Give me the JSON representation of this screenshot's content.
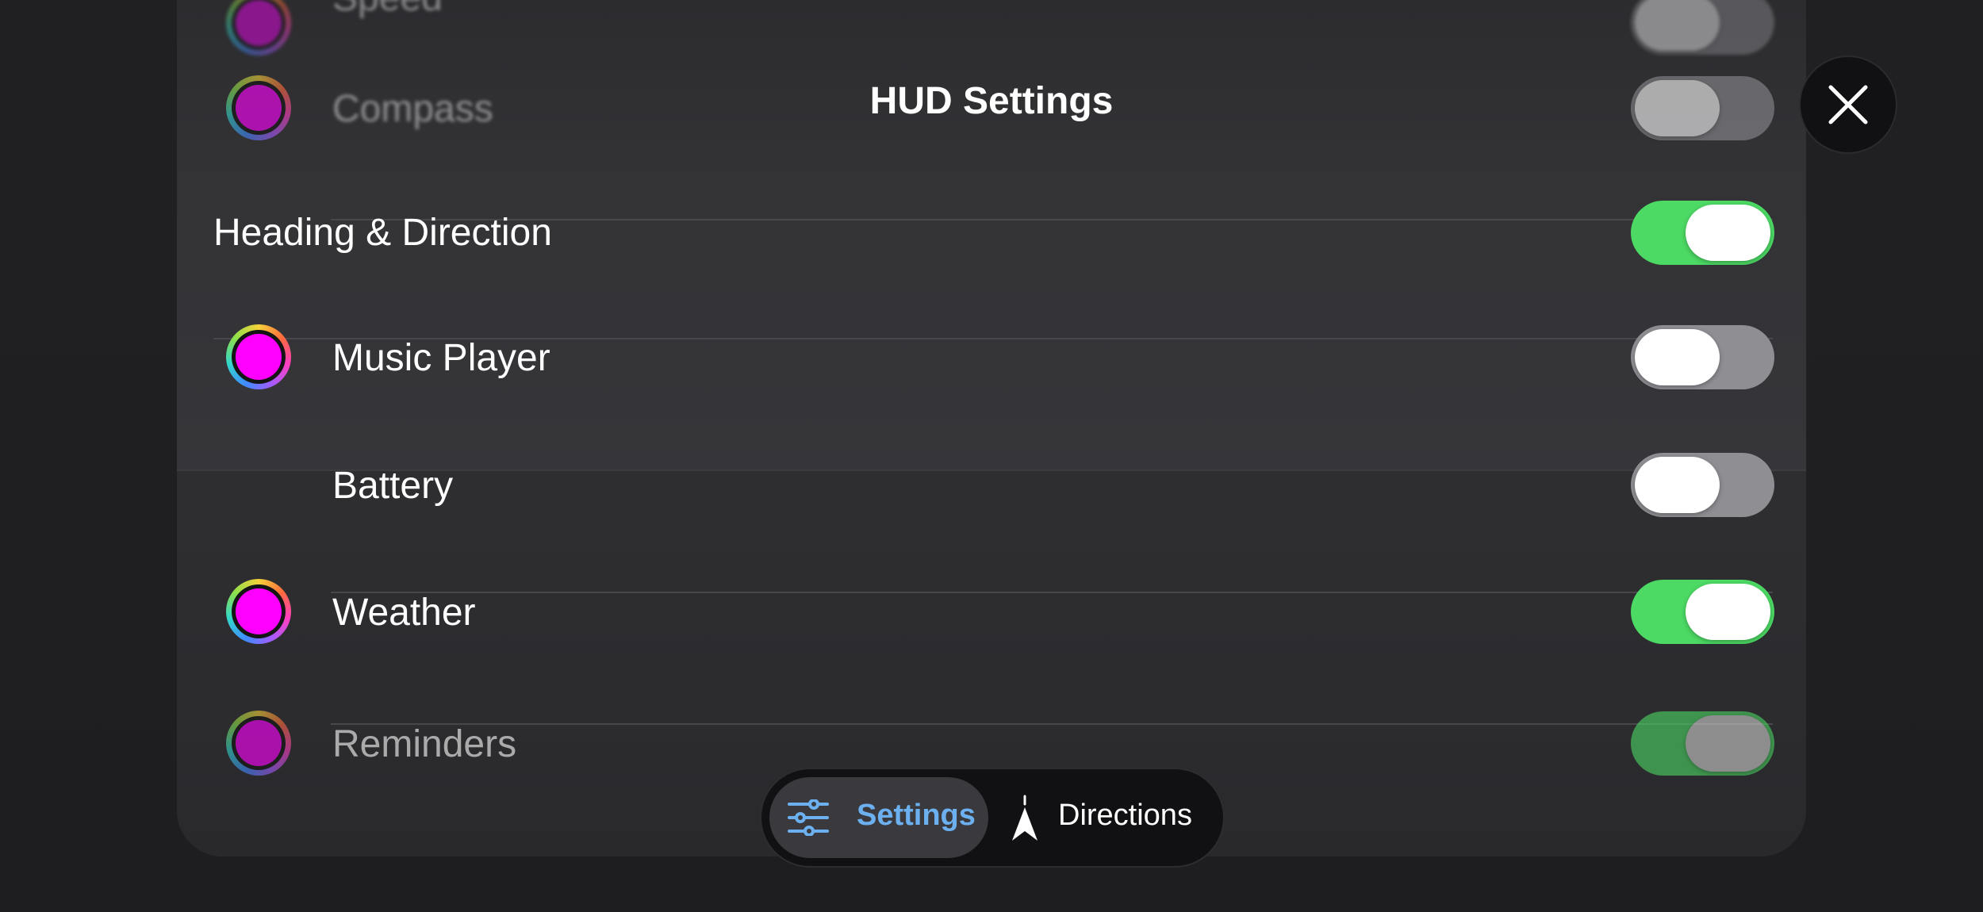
{
  "header": {
    "title": "HUD Settings"
  },
  "close_button": {
    "icon": "close-icon"
  },
  "settings": [
    {
      "label": "Speed",
      "icon": "color-ring-icon",
      "toggle": "off"
    },
    {
      "label": "Compass",
      "icon": "color-ring-icon",
      "toggle": "off"
    },
    {
      "label": "Heading & Direction",
      "toggle": "on"
    },
    {
      "label": "Music Player",
      "icon": "color-ring-icon",
      "toggle": "off"
    },
    {
      "label": "Battery",
      "toggle": "off"
    },
    {
      "label": "Weather",
      "icon": "color-ring-icon",
      "toggle": "on"
    },
    {
      "label": "Reminders",
      "icon": "color-ring-icon",
      "toggle": "on"
    }
  ],
  "tabs": [
    {
      "label": "Settings",
      "icon": "sliders-icon",
      "selected": true
    },
    {
      "label": "Directions",
      "icon": "navigation-arrow-icon",
      "selected": false
    }
  ],
  "colors": {
    "toggle_on": "#4cd964",
    "toggle_off": "#8e8e93",
    "accent": "#6cb0f0",
    "indicator": "#ff00ff"
  }
}
